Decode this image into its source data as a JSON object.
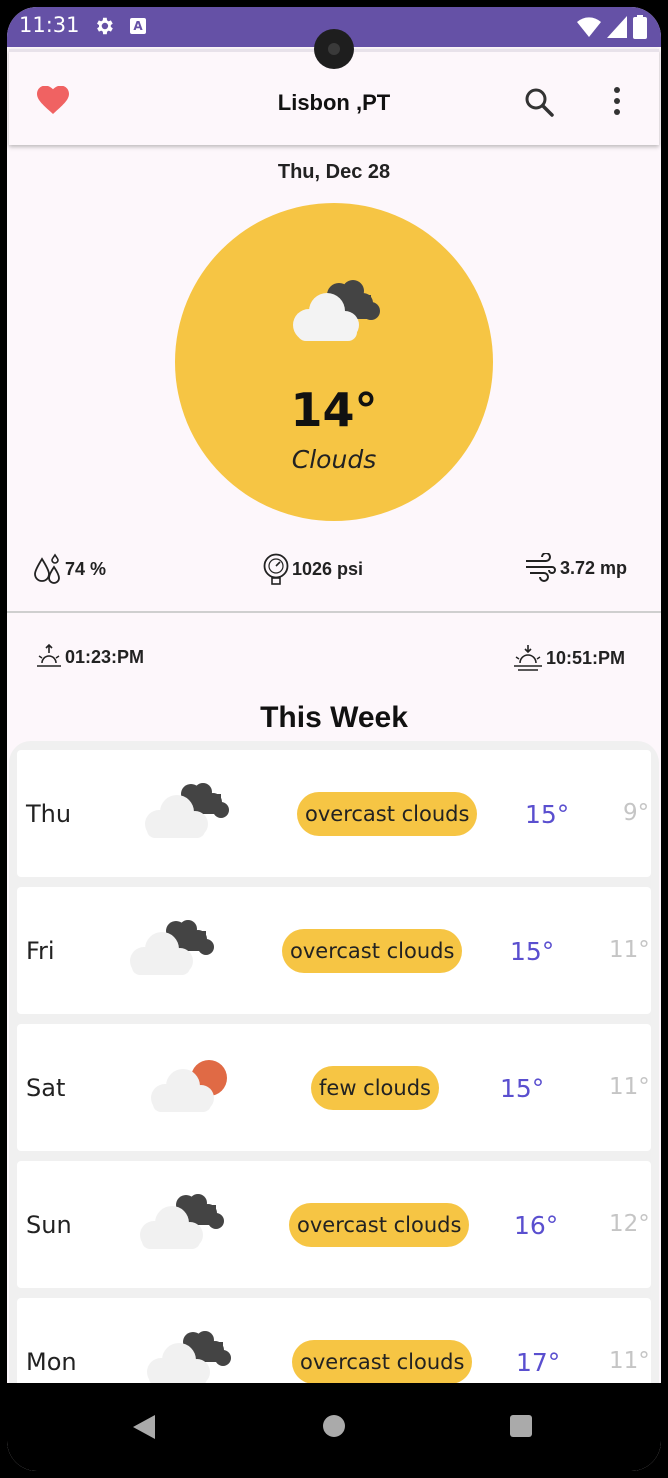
{
  "status_bar": {
    "time": "11:31",
    "a_badge": "A"
  },
  "header": {
    "title": "Lisbon ,PT"
  },
  "current": {
    "date": "Thu, Dec 28",
    "temperature": "14°",
    "description": "Clouds",
    "humidity": "74 %",
    "pressure": "1026 psi",
    "wind": "3.72 mp",
    "sunrise": "01:23:PM",
    "sunset": "10:51:PM"
  },
  "week": {
    "title": "This Week",
    "days": [
      {
        "name": "Thu",
        "icon": "overcast-clouds-icon",
        "desc": "overcast clouds",
        "max": "15°",
        "min": "9°"
      },
      {
        "name": "Fri",
        "icon": "overcast-clouds-icon",
        "desc": "overcast clouds",
        "max": "15°",
        "min": "11°"
      },
      {
        "name": "Sat",
        "icon": "few-clouds-icon",
        "desc": "few clouds",
        "max": "15°",
        "min": "11°"
      },
      {
        "name": "Sun",
        "icon": "overcast-clouds-icon",
        "desc": "overcast clouds",
        "max": "16°",
        "min": "12°"
      },
      {
        "name": "Mon",
        "icon": "overcast-clouds-icon",
        "desc": "overcast clouds",
        "max": "17°",
        "min": "11°"
      }
    ]
  },
  "colors": {
    "status_bar": "#6551a6",
    "accent_yellow": "#f6c544",
    "heart": "#f06262",
    "max_temp": "#5a4fcf",
    "min_temp": "#c5c5c5"
  }
}
